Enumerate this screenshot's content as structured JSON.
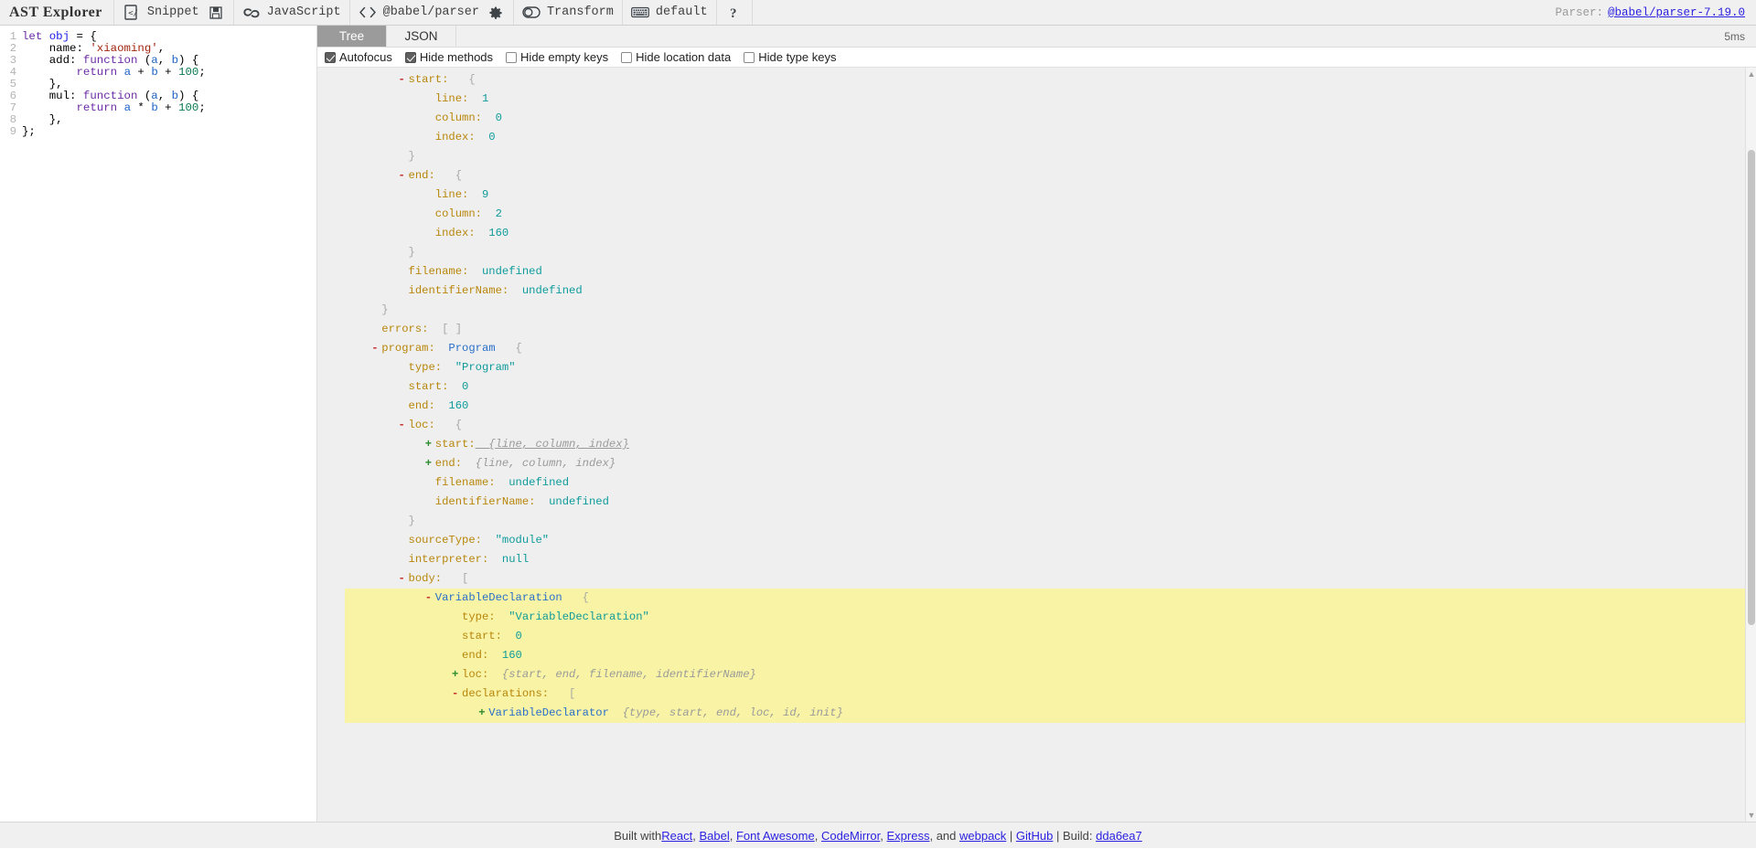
{
  "toolbar": {
    "brand": "AST Explorer",
    "items": [
      {
        "icon": "snippet-file-icon",
        "label": "Snippet",
        "trailing_icon": "save-icon"
      },
      {
        "icon": "babel-infinity-icon",
        "label": "JavaScript",
        "trailing_icon": ""
      },
      {
        "icon": "code-brackets-icon",
        "label": "@babel/parser",
        "trailing_icon": "gear-icon"
      },
      {
        "icon": "toggle-switch-icon",
        "label": "Transform",
        "trailing_icon": ""
      },
      {
        "icon": "keyboard-icon",
        "label": "default",
        "trailing_icon": ""
      },
      {
        "icon": "help-question-icon",
        "label": "",
        "trailing_icon": ""
      }
    ],
    "parser_label": "Parser:",
    "parser_version": "@babel/parser-7.19.0"
  },
  "editor": {
    "lines": [
      {
        "n": "1",
        "tokens": [
          {
            "t": "let ",
            "c": "kw"
          },
          {
            "t": "obj",
            "c": "def"
          },
          {
            "t": " = {",
            "c": "pun"
          }
        ]
      },
      {
        "n": "2",
        "tokens": [
          {
            "t": "    name: ",
            "c": "pun"
          },
          {
            "t": "'xiaoming'",
            "c": "str"
          },
          {
            "t": ",",
            "c": "pun"
          }
        ]
      },
      {
        "n": "3",
        "tokens": [
          {
            "t": "    add: ",
            "c": "pun"
          },
          {
            "t": "function",
            "c": "kw"
          },
          {
            "t": " (",
            "c": "pun"
          },
          {
            "t": "a",
            "c": "var"
          },
          {
            "t": ", ",
            "c": "pun"
          },
          {
            "t": "b",
            "c": "var"
          },
          {
            "t": ") {",
            "c": "pun"
          }
        ]
      },
      {
        "n": "4",
        "tokens": [
          {
            "t": "        ",
            "c": "pun"
          },
          {
            "t": "return",
            "c": "kw"
          },
          {
            "t": " ",
            "c": "pun"
          },
          {
            "t": "a",
            "c": "var"
          },
          {
            "t": " + ",
            "c": "pun"
          },
          {
            "t": "b",
            "c": "var"
          },
          {
            "t": " + ",
            "c": "pun"
          },
          {
            "t": "100",
            "c": "num"
          },
          {
            "t": ";",
            "c": "pun"
          }
        ]
      },
      {
        "n": "5",
        "tokens": [
          {
            "t": "    },",
            "c": "pun"
          }
        ]
      },
      {
        "n": "6",
        "tokens": [
          {
            "t": "    mul: ",
            "c": "pun"
          },
          {
            "t": "function",
            "c": "kw"
          },
          {
            "t": " (",
            "c": "pun"
          },
          {
            "t": "a",
            "c": "var"
          },
          {
            "t": ", ",
            "c": "pun"
          },
          {
            "t": "b",
            "c": "var"
          },
          {
            "t": ") {",
            "c": "pun"
          }
        ]
      },
      {
        "n": "7",
        "tokens": [
          {
            "t": "        ",
            "c": "pun"
          },
          {
            "t": "return",
            "c": "kw"
          },
          {
            "t": " ",
            "c": "pun"
          },
          {
            "t": "a",
            "c": "var"
          },
          {
            "t": " * ",
            "c": "pun"
          },
          {
            "t": "b",
            "c": "var"
          },
          {
            "t": " + ",
            "c": "pun"
          },
          {
            "t": "100",
            "c": "num"
          },
          {
            "t": ";",
            "c": "pun"
          }
        ]
      },
      {
        "n": "8",
        "tokens": [
          {
            "t": "    },",
            "c": "pun"
          }
        ]
      },
      {
        "n": "9",
        "tokens": [
          {
            "t": "};",
            "c": "pun"
          }
        ]
      }
    ]
  },
  "ast_panel": {
    "tabs": [
      {
        "label": "Tree",
        "active": true
      },
      {
        "label": "JSON",
        "active": false
      }
    ],
    "timing": "5ms",
    "options": [
      {
        "label": "Autofocus",
        "checked": true
      },
      {
        "label": "Hide methods",
        "checked": true
      },
      {
        "label": "Hide empty keys",
        "checked": false
      },
      {
        "label": "Hide location data",
        "checked": false
      },
      {
        "label": "Hide type keys",
        "checked": false
      }
    ],
    "tree_rows": [
      {
        "indent": 3,
        "toggle": "-",
        "key": "start:",
        "brace": "{",
        "highlight": false
      },
      {
        "indent": 4,
        "toggle": "",
        "key": "line:",
        "value": "1",
        "vtype": "num",
        "highlight": false
      },
      {
        "indent": 4,
        "toggle": "",
        "key": "column:",
        "value": "0",
        "vtype": "num",
        "highlight": false
      },
      {
        "indent": 4,
        "toggle": "",
        "key": "index:",
        "value": "0",
        "vtype": "num",
        "highlight": false
      },
      {
        "indent": 3,
        "toggle": "",
        "closing": "}",
        "highlight": false
      },
      {
        "indent": 3,
        "toggle": "-",
        "key": "end:",
        "brace": "{",
        "highlight": false
      },
      {
        "indent": 4,
        "toggle": "",
        "key": "line:",
        "value": "9",
        "vtype": "num",
        "highlight": false
      },
      {
        "indent": 4,
        "toggle": "",
        "key": "column:",
        "value": "2",
        "vtype": "num",
        "highlight": false
      },
      {
        "indent": 4,
        "toggle": "",
        "key": "index:",
        "value": "160",
        "vtype": "num",
        "highlight": false
      },
      {
        "indent": 3,
        "toggle": "",
        "closing": "}",
        "highlight": false
      },
      {
        "indent": 3,
        "toggle": "",
        "key": "filename:",
        "value": "undefined",
        "vtype": "num",
        "highlight": false
      },
      {
        "indent": 3,
        "toggle": "",
        "key": "identifierName:",
        "value": "undefined",
        "vtype": "num",
        "highlight": false
      },
      {
        "indent": 2,
        "toggle": "",
        "closing": "}",
        "highlight": false
      },
      {
        "indent": 2,
        "toggle": "",
        "key": "errors:",
        "value": "[ ]",
        "vtype": "brk",
        "highlight": false
      },
      {
        "indent": 2,
        "toggle": "-",
        "key": "program:",
        "nodetype": "Program",
        "brace": "{",
        "highlight": false
      },
      {
        "indent": 3,
        "toggle": "",
        "key": "type:",
        "value": "\"Program\"",
        "vtype": "str",
        "highlight": false
      },
      {
        "indent": 3,
        "toggle": "",
        "key": "start:",
        "value": "0",
        "vtype": "num",
        "highlight": false
      },
      {
        "indent": 3,
        "toggle": "",
        "key": "end:",
        "value": "160",
        "vtype": "num",
        "highlight": false
      },
      {
        "indent": 3,
        "toggle": "-",
        "key": "loc:",
        "brace": "{",
        "highlight": false
      },
      {
        "indent": 4,
        "toggle": "+",
        "key": "start:",
        "preview": "{line, column, index}",
        "underline": true,
        "highlight": false
      },
      {
        "indent": 4,
        "toggle": "+",
        "key": "end:",
        "preview": "{line, column, index}",
        "underline": false,
        "highlight": false
      },
      {
        "indent": 4,
        "toggle": "",
        "key": "filename:",
        "value": "undefined",
        "vtype": "num",
        "highlight": false
      },
      {
        "indent": 4,
        "toggle": "",
        "key": "identifierName:",
        "value": "undefined",
        "vtype": "num",
        "highlight": false
      },
      {
        "indent": 3,
        "toggle": "",
        "closing": "}",
        "highlight": false
      },
      {
        "indent": 3,
        "toggle": "",
        "key": "sourceType:",
        "value": "\"module\"",
        "vtype": "str",
        "highlight": false
      },
      {
        "indent": 3,
        "toggle": "",
        "key": "interpreter:",
        "value": "null",
        "vtype": "num",
        "highlight": false
      },
      {
        "indent": 3,
        "toggle": "-",
        "key": "body:",
        "brace": "[",
        "highlight": false
      },
      {
        "indent": 4,
        "toggle": "-",
        "nodeonly": "VariableDeclaration",
        "brace": "{",
        "highlight": true
      },
      {
        "indent": 5,
        "toggle": "",
        "key": "type:",
        "value": "\"VariableDeclaration\"",
        "vtype": "str",
        "highlight": true
      },
      {
        "indent": 5,
        "toggle": "",
        "key": "start:",
        "value": "0",
        "vtype": "num",
        "highlight": true
      },
      {
        "indent": 5,
        "toggle": "",
        "key": "end:",
        "value": "160",
        "vtype": "num",
        "highlight": true
      },
      {
        "indent": 5,
        "toggle": "+",
        "key": "loc:",
        "preview": "{start, end, filename, identifierName}",
        "underline": false,
        "highlight": true
      },
      {
        "indent": 5,
        "toggle": "-",
        "key": "declarations:",
        "brace": "[",
        "highlight": true
      },
      {
        "indent": 6,
        "toggle": "+",
        "nodeonly": "VariableDeclarator",
        "preview": "{type, start, end, loc, id, init}",
        "underline": false,
        "highlight": true
      }
    ]
  },
  "footer": {
    "prefix": "Built with ",
    "links": [
      {
        "label": "React",
        "after": ", "
      },
      {
        "label": "Babel",
        "after": ", "
      },
      {
        "label": "Font Awesome",
        "after": ", "
      },
      {
        "label": "CodeMirror",
        "after": ", "
      },
      {
        "label": "Express",
        "after": ", and "
      },
      {
        "label": "webpack",
        "after": " | "
      },
      {
        "label": "GitHub",
        "after": " | Build: "
      },
      {
        "label": "dda6ea7",
        "after": ""
      }
    ]
  },
  "colors": {
    "accent_link": "#2b21e0",
    "key": "#b8860b",
    "value": "#0f9b9b",
    "node_type": "#2a6fc9",
    "toggle_minus": "#c62828",
    "toggle_plus": "#2e8b2e",
    "highlight_bg": "#f8f3a5",
    "tab_active_bg": "#9b9b9b"
  }
}
